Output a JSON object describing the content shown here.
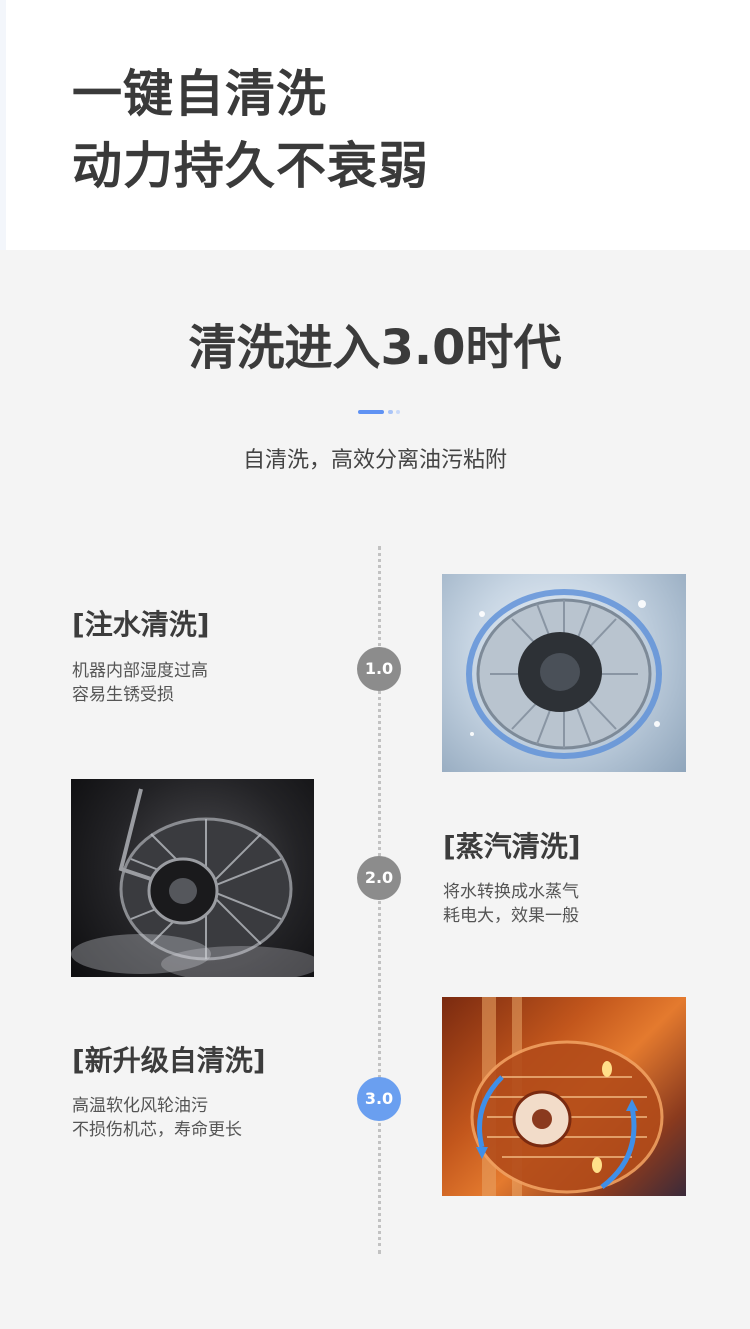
{
  "hero": {
    "line1": "一键自清洗",
    "line2": "动力持久不衰弱"
  },
  "section": {
    "title": "清洗进入3.0时代",
    "subtitle": "自清洗，高效分离油污粘附"
  },
  "stages": [
    {
      "badge": "1.0",
      "title": "[注水清洗]",
      "desc1": "机器内部湿度过高",
      "desc2": "容易生锈受损",
      "image_icon": "water-splash-fan-icon"
    },
    {
      "badge": "2.0",
      "title": "[蒸汽清洗]",
      "desc1": "将水转换成水蒸气",
      "desc2": "耗电大，效果一般",
      "image_icon": "steam-fan-icon"
    },
    {
      "badge": "3.0",
      "title": "[新升级自清洗]",
      "desc1": "高温软化风轮油污",
      "desc2": "不损伤机芯，寿命更长",
      "image_icon": "heated-fan-icon"
    }
  ],
  "colors": {
    "accent": "#6a9ff0",
    "badge_gray": "#8c8c8c",
    "text_dark": "#3a3a3a",
    "background": "#f4f4f4"
  }
}
